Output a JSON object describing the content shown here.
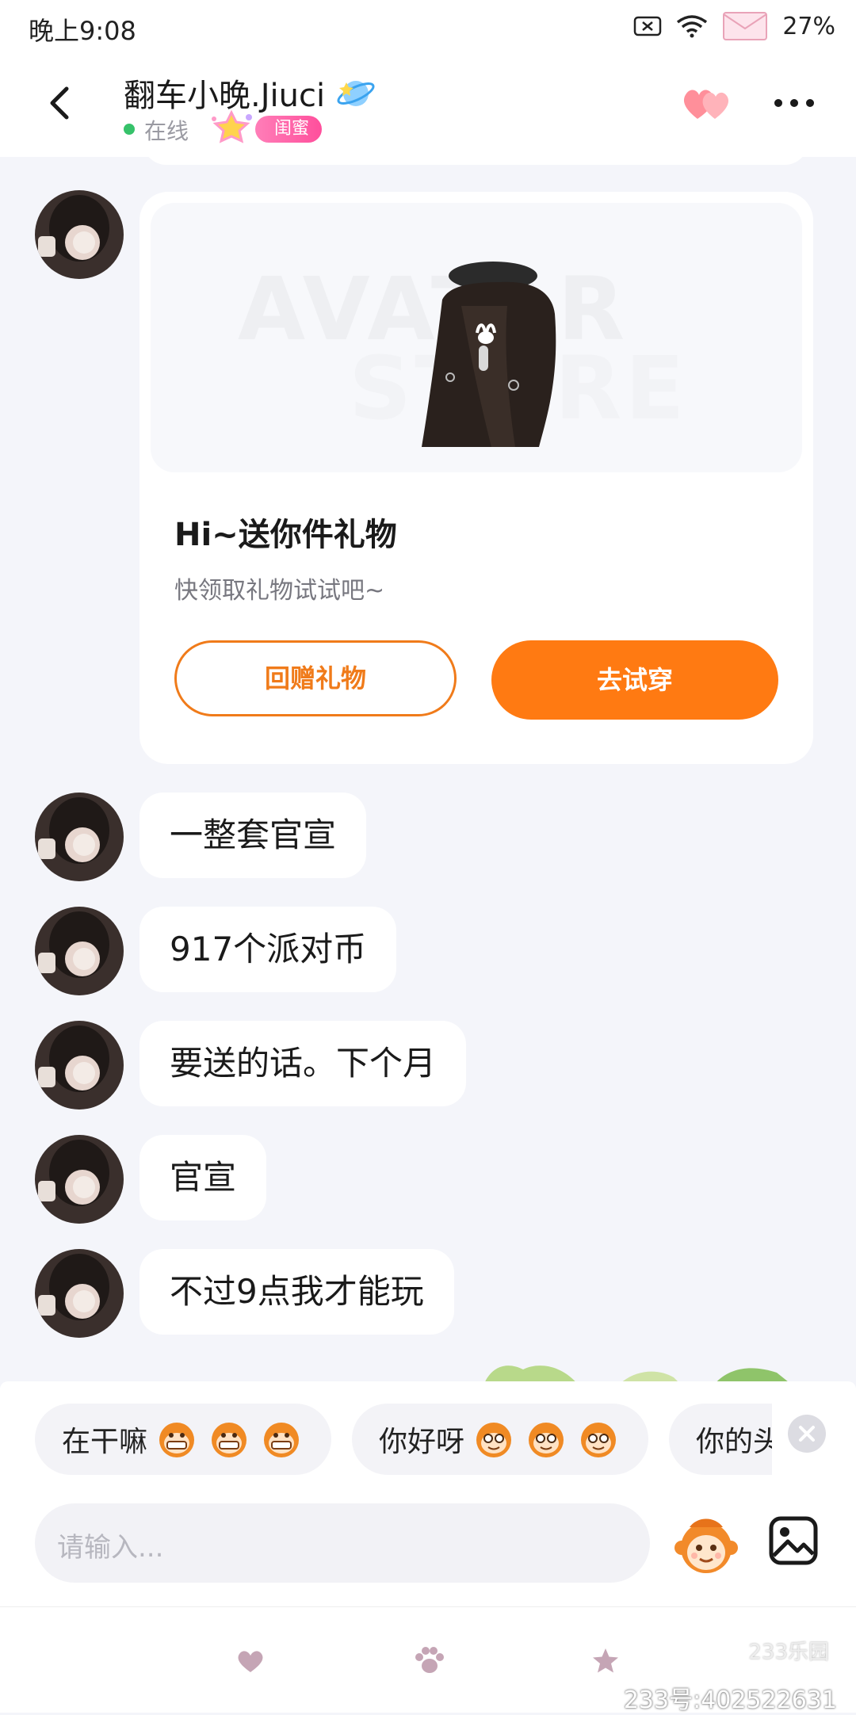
{
  "status_bar": {
    "time": "晚上9:08",
    "battery": "27%"
  },
  "header": {
    "contact_name": "翻车小晚.Jiuci",
    "status": "在线",
    "badge": "闺蜜"
  },
  "gift_card": {
    "watermark_line1": "AVATAR",
    "watermark_line2": "STORE",
    "title": "Hi~送你件礼物",
    "subtitle": "快领取礼物试试吧~",
    "return_gift_label": "回赠礼物",
    "try_on_label": "去试穿"
  },
  "messages": [
    {
      "text": "一整套官宣"
    },
    {
      "text": "917个派对币"
    },
    {
      "text": "要送的话。下个月"
    },
    {
      "text": "官宣"
    },
    {
      "text": "不过9点我才能玩"
    }
  ],
  "quick_replies": [
    {
      "text": "在干嘛"
    },
    {
      "text": "你好呀"
    },
    {
      "text": "你的头"
    }
  ],
  "input": {
    "placeholder": "请输入..."
  },
  "footer": {
    "logo": "233乐园",
    "user_id": "233号:402522631"
  },
  "colors": {
    "accent_orange": "#ff7a12",
    "online_green": "#36c26a",
    "badge_pink": "#ff4f9c"
  }
}
